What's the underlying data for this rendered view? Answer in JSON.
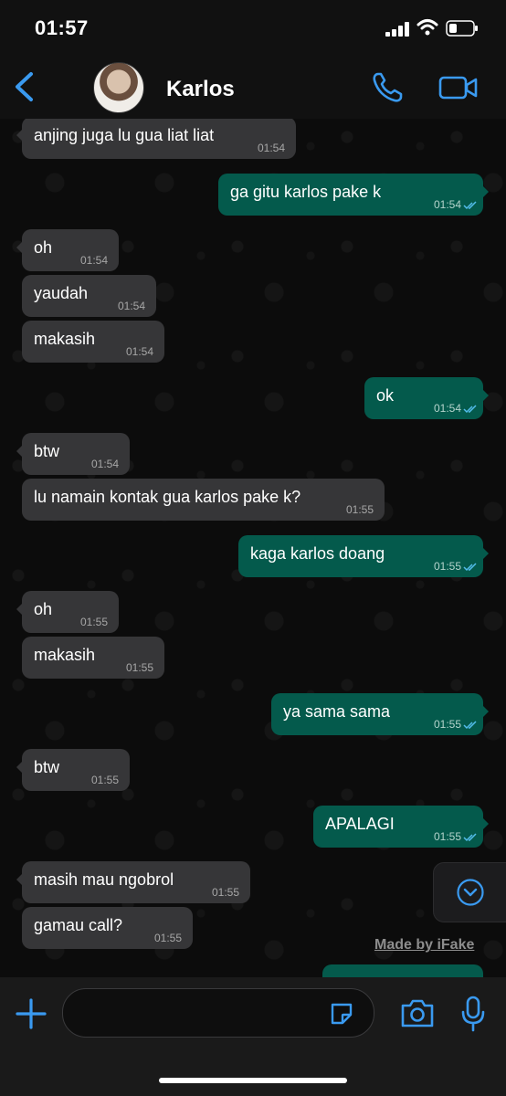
{
  "status_bar": {
    "time": "01:57"
  },
  "header": {
    "contact_name": "Karlos"
  },
  "messages": [
    {
      "dir": "in",
      "text": "anjing juga lu gua liat liat",
      "time": "01:54"
    },
    {
      "dir": "out",
      "text": "ga gitu karlos pake k",
      "time": "01:54"
    },
    {
      "dir": "in",
      "text": "oh",
      "time": "01:54"
    },
    {
      "dir": "in",
      "text": "yaudah",
      "time": "01:54"
    },
    {
      "dir": "in",
      "text": "makasih",
      "time": "01:54"
    },
    {
      "dir": "out",
      "text": "ok",
      "time": "01:54"
    },
    {
      "dir": "in",
      "text": "btw",
      "time": "01:54"
    },
    {
      "dir": "in",
      "text": "lu namain kontak gua karlos pake k?",
      "time": "01:55"
    },
    {
      "dir": "out",
      "text": "kaga karlos doang",
      "time": "01:55"
    },
    {
      "dir": "in",
      "text": "oh",
      "time": "01:55"
    },
    {
      "dir": "in",
      "text": "makasih",
      "time": "01:55"
    },
    {
      "dir": "out",
      "text": "ya sama sama",
      "time": "01:55"
    },
    {
      "dir": "in",
      "text": "btw",
      "time": "01:55"
    },
    {
      "dir": "out",
      "text": "APALAGI",
      "time": "01:55"
    },
    {
      "dir": "in",
      "text": "masih mau ngobrol",
      "time": "01:55"
    },
    {
      "dir": "in",
      "text": "gamau call?",
      "time": "01:55"
    }
  ],
  "watermark": "Made by iFake",
  "input": {
    "placeholder": ""
  },
  "colors": {
    "accent": "#3a9af0",
    "incoming_bubble": "#363638",
    "outgoing_bubble": "#045a4c",
    "read_ticks": "#53bdeb"
  }
}
